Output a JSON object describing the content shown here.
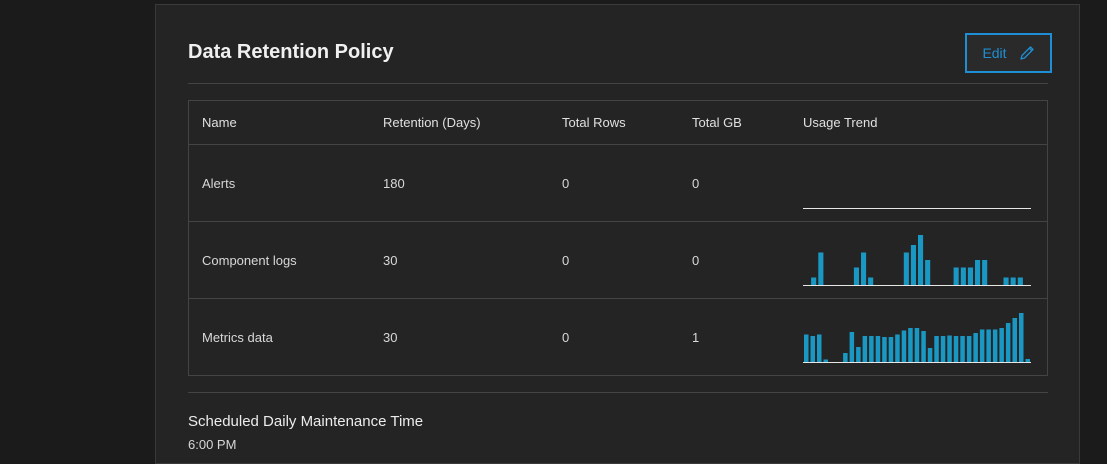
{
  "panel": {
    "title": "Data Retention Policy",
    "edit_label": "Edit",
    "edit_icon": "pencil-icon",
    "accent_color": "#1e8fd6",
    "bar_color": "#1a98c4"
  },
  "table": {
    "columns": [
      "Name",
      "Retention (Days)",
      "Total Rows",
      "Total GB",
      "Usage Trend"
    ],
    "rows": [
      {
        "name": "Alerts",
        "retention": "180",
        "total_rows": "0",
        "total_gb": "0",
        "trend": [
          0,
          0,
          0,
          0,
          0,
          0,
          0,
          0,
          0,
          0,
          0,
          0,
          0,
          0,
          0,
          0,
          0,
          0,
          0,
          0,
          0,
          0,
          0,
          0,
          0,
          0,
          0,
          0,
          0,
          0,
          0,
          0
        ]
      },
      {
        "name": "Component logs",
        "retention": "30",
        "total_rows": "0",
        "total_gb": "0",
        "trend": [
          0,
          0.15,
          0.65,
          0,
          0,
          0,
          0,
          0.35,
          0.65,
          0.15,
          0,
          0,
          0,
          0,
          0.65,
          0.8,
          1,
          0.5,
          0,
          0,
          0,
          0.35,
          0.35,
          0.35,
          0.5,
          0.5,
          0,
          0,
          0.15,
          0.15,
          0.15,
          0
        ]
      },
      {
        "name": "Metrics data",
        "retention": "30",
        "total_rows": "0",
        "total_gb": "1",
        "trend": [
          0.55,
          0.52,
          0.55,
          0.05,
          0,
          0,
          0.18,
          0.6,
          0.3,
          0.52,
          0.52,
          0.52,
          0.5,
          0.5,
          0.55,
          0.63,
          0.68,
          0.68,
          0.62,
          0.28,
          0.52,
          0.52,
          0.53,
          0.52,
          0.52,
          0.52,
          0.58,
          0.65,
          0.65,
          0.65,
          0.68,
          0.78,
          0.88,
          0.98,
          0.06
        ]
      }
    ]
  },
  "maintenance": {
    "title": "Scheduled Daily Maintenance Time",
    "value": "6:00 PM"
  }
}
